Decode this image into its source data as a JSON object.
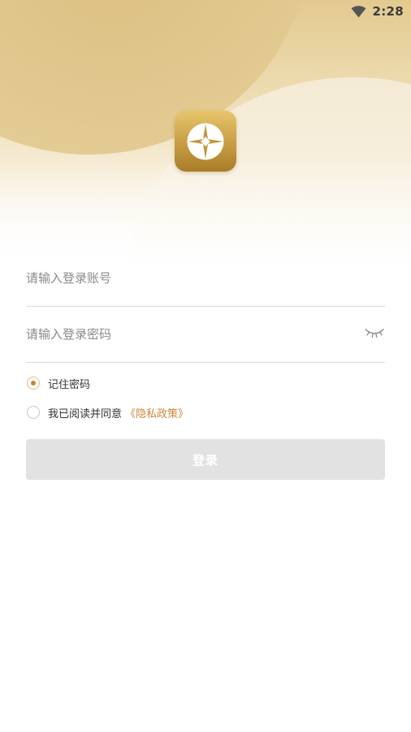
{
  "status_bar": {
    "time": "2:28",
    "icons": [
      "wifi-icon"
    ]
  },
  "app": {
    "logo_icon": "coin-logo-icon",
    "accent_color": "#c9a047"
  },
  "login_form": {
    "account_placeholder": "请输入登录账号",
    "password_placeholder": "请输入登录密码",
    "password_toggle_icon": "eye-closed-icon",
    "remember_password_label": "记住密码",
    "remember_password_checked": true,
    "agree_prefix": "我已阅读并同意",
    "agree_checked": false,
    "privacy_link_label": "《隐私政策》",
    "privacy_link_color": "#c9873c",
    "login_button_label": "登录",
    "login_button_color": "#e2e2e2"
  }
}
